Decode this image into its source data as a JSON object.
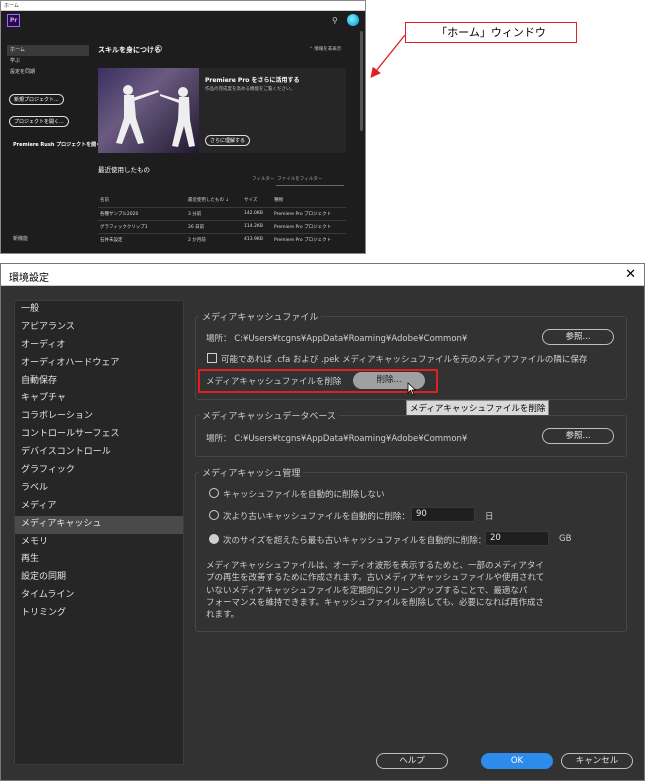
{
  "home": {
    "window_title": "ホーム",
    "sidebar": [
      "ホーム",
      "学ぶ",
      "設定を同期"
    ],
    "new_project": "新規プロジェクト...",
    "open_project": "プロジェクトを開く...",
    "rush": "Premiere Rush プロジェクトを開く...",
    "newsroom": "新機能",
    "skills_title": "スキルを身につける",
    "hide_info": "情報を非表示",
    "hero_title": "Premiere Pro をさらに活用する",
    "hero_sub": "作品の完成度を高める機能をご覧ください。",
    "hero_btn": "さらに理解する",
    "recent_title": "最近使用したもの",
    "filter_label": "フィルター",
    "filter_placeholder": "ファイルをフィルター",
    "table": {
      "headers": [
        "名前",
        "最近使用したもの ↓",
        "サイズ",
        "種類"
      ],
      "rows": [
        [
          "各種サンプル2020",
          "3 分前",
          "142.0KB",
          "Premiere Pro プロジェクト"
        ],
        [
          "グラフィッククリップ1",
          "26 日前",
          "114.2KB",
          "Premiere Pro プロジェクト"
        ],
        [
          "石井未設定",
          "2 か月前",
          "413.9KB",
          "Premiere Pro プロジェクト"
        ]
      ]
    }
  },
  "callout": "「ホーム」ウィンドウ",
  "prefs": {
    "title": "環境設定",
    "categories": [
      "一般",
      "アピアランス",
      "オーディオ",
      "オーディオハードウェア",
      "自動保存",
      "キャプチャ",
      "コラボレーション",
      "コントロールサーフェス",
      "デバイスコントロール",
      "グラフィック",
      "ラベル",
      "メディア",
      "メディアキャッシュ",
      "メモリ",
      "再生",
      "設定の同期",
      "タイムライン",
      "トリミング"
    ],
    "selected_category": "メディアキャッシュ",
    "cache_files": {
      "legend": "メディアキャッシュファイル",
      "location_label": "場所：",
      "location_path": "C:¥Users¥tcgns¥AppData¥Roaming¥Adobe¥Common¥",
      "browse": "参照...",
      "save_next_label": "可能であれば .cfa および .pek メディアキャッシュファイルを元のメディアファイルの隣に保存",
      "delete_label": "メディアキャッシュファイルを削除",
      "delete_btn": "削除...",
      "tooltip": "メディアキャッシュファイルを削除"
    },
    "cache_db": {
      "legend": "メディアキャッシュデータベース",
      "location_label": "場所：",
      "location_path": "C:¥Users¥tcgns¥AppData¥Roaming¥Adobe¥Common¥",
      "browse": "参照..."
    },
    "cache_mgmt": {
      "legend": "メディアキャッシュ管理",
      "opt1": "キャッシュファイルを自動的に削除しない",
      "opt2": "次より古いキャッシュファイルを自動的に削除：",
      "opt2_value": "90",
      "opt2_unit": "日",
      "opt3": "次のサイズを超えたら最も古いキャッシュファイルを自動的に削除：",
      "opt3_value": "20",
      "opt3_unit": "GB",
      "desc_lines": [
        "メディアキャッシュファイルは、オーディオ波形を表示するためと、一部のメディアタイ",
        "プの再生を改善するために作成されます。古いメディアキャッシュファイルや使用されて",
        "いないメディアキャッシュファイルを定期的にクリーンアップすることで、最適なパ",
        "フォーマンスを維持できます。キャッシュファイルを削除しても、必要になれば再作成さ",
        "れます。"
      ]
    },
    "footer": {
      "help": "ヘルプ",
      "ok": "OK",
      "cancel": "キャンセル"
    }
  }
}
